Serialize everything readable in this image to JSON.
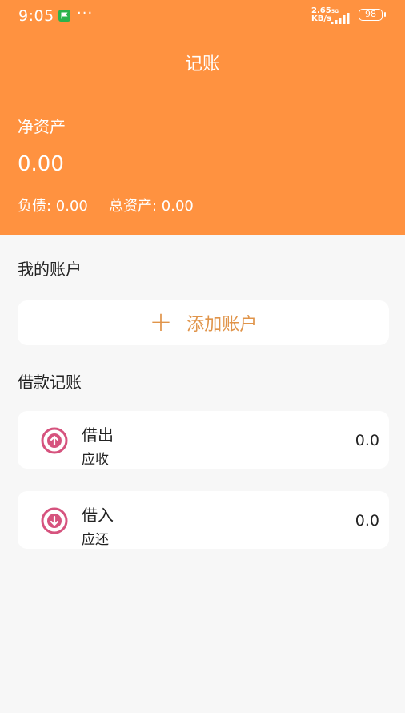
{
  "status_bar": {
    "time": "9:05",
    "more": "···",
    "speed_value": "2.65",
    "speed_unit": "KB/s",
    "network": "5G",
    "battery": "98"
  },
  "header": {
    "title": "记账",
    "net_assets_label": "净资产",
    "net_assets_value": "0.00",
    "debt_text": "负债: 0.00",
    "total_assets_text": "总资产: 0.00"
  },
  "accounts": {
    "section_title": "我的账户",
    "add_icon": "plus-icon",
    "add_label": "添加账户"
  },
  "loans": {
    "section_title": "借款记账",
    "items": [
      {
        "name": "借出",
        "sub": "应收",
        "amount": "0.0",
        "icon": "arrow-up-circle-icon"
      },
      {
        "name": "借入",
        "sub": "应还",
        "amount": "0.0",
        "icon": "arrow-down-circle-icon"
      }
    ]
  },
  "colors": {
    "header_bg": "#ff9240",
    "accent_text": "#e0944a",
    "loan_icon": "#d6537e",
    "page_bg": "#f7f7f7"
  }
}
